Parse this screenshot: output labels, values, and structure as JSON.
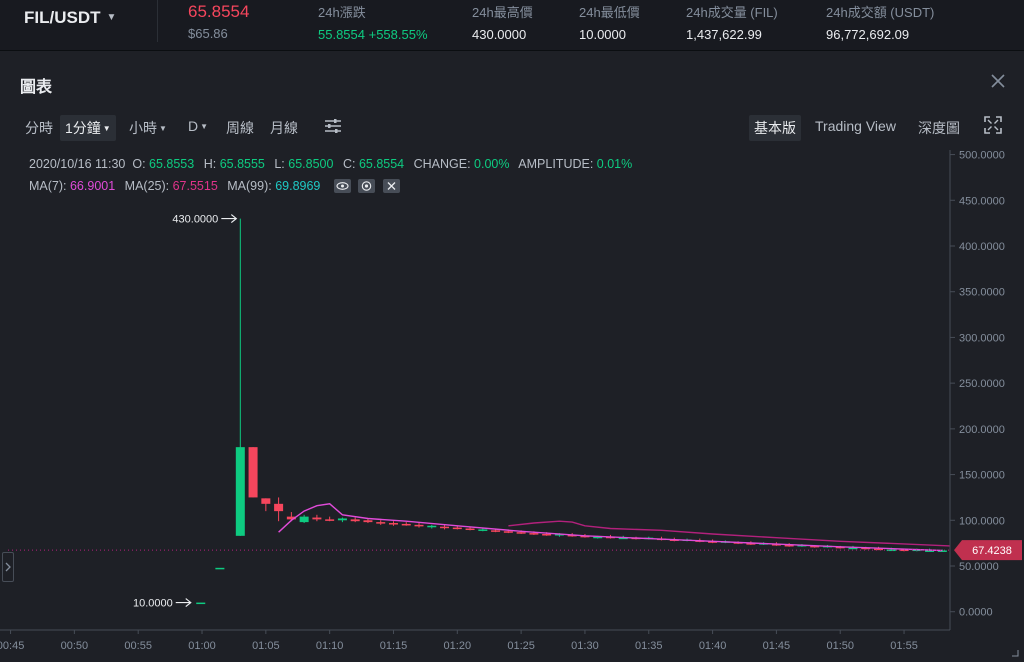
{
  "ticker": {
    "pair": "FIL/USDT",
    "last_price": "65.8554",
    "last_price_usd": "$65.86",
    "stats": [
      {
        "label": "24h漲跌",
        "value": "55.8554 +558.55%",
        "positive": true
      },
      {
        "label": "24h最高價",
        "value": "430.0000",
        "positive": false
      },
      {
        "label": "24h最低價",
        "value": "10.0000",
        "positive": false
      },
      {
        "label": "24h成交量 (FIL)",
        "value": "1,437,622.99",
        "positive": false
      },
      {
        "label": "24h成交額 (USDT)",
        "value": "96,772,692.09",
        "positive": false
      }
    ]
  },
  "panel": {
    "title": "圖表"
  },
  "toolbar": {
    "intervals": [
      {
        "label": "分時",
        "dropdown": false,
        "active": false
      },
      {
        "label": "1分鐘",
        "dropdown": true,
        "active": true
      },
      {
        "label": "小時",
        "dropdown": true,
        "active": false
      },
      {
        "label": "D",
        "dropdown": true,
        "active": false
      },
      {
        "label": "周線",
        "dropdown": false,
        "active": false
      },
      {
        "label": "月線",
        "dropdown": false,
        "active": false
      }
    ],
    "views": [
      {
        "label": "基本版",
        "active": true
      },
      {
        "label": "Trading View",
        "active": false
      },
      {
        "label": "深度圖",
        "active": false
      }
    ]
  },
  "ohlc": {
    "time": "2020/10/16 11:30",
    "o_label": "O:",
    "o": "65.8553",
    "h_label": "H:",
    "h": "65.8555",
    "l_label": "L:",
    "l": "65.8500",
    "c_label": "C:",
    "c": "65.8554",
    "change_label": "CHANGE:",
    "change": "0.00%",
    "amp_label": "AMPLITUDE:",
    "amp": "0.01%"
  },
  "ma": {
    "ma7_label": "MA(7):",
    "ma7": "66.9001",
    "ma25_label": "MA(25):",
    "ma25": "67.5515",
    "ma99_label": "MA(99):",
    "ma99": "69.8969"
  },
  "colors": {
    "up": "#0ecb81",
    "down": "#f6465d",
    "ma7": "#e04bd9",
    "ma25": "#b2217c",
    "bg": "#1e2026",
    "grid": "#2b2f36"
  },
  "chart_data": {
    "type": "candlestick",
    "ylim": [
      -20,
      505
    ],
    "y_ticks": [
      "500.0000",
      "450.0000",
      "400.0000",
      "350.0000",
      "300.0000",
      "250.0000",
      "200.0000",
      "150.0000",
      "100.0000",
      "50.0000",
      "0.0000"
    ],
    "y_tick_values": [
      500,
      450,
      400,
      350,
      300,
      250,
      200,
      150,
      100,
      50,
      0
    ],
    "x_ticks": [
      "00:45",
      "00:50",
      "00:55",
      "01:00",
      "01:05",
      "01:10",
      "01:15",
      "01:20",
      "01:25",
      "01:30",
      "01:35",
      "01:40",
      "01:45",
      "01:50",
      "01:55"
    ],
    "x_tick_minutes": [
      45,
      50,
      55,
      60,
      65,
      70,
      75,
      80,
      85,
      90,
      95,
      100,
      105,
      110,
      115
    ],
    "x_range_minutes": [
      44.8,
      118.6
    ],
    "high_marker": "430.0000",
    "low_marker": "10.0000",
    "last_label": "67.4238",
    "last_value": 67.4238,
    "candles": [
      {
        "t": 59.9,
        "o": 10,
        "h": 10,
        "l": 10,
        "c": 10
      },
      {
        "t": 61.4,
        "o": 48,
        "h": 48,
        "l": 48,
        "c": 48
      },
      {
        "t": 63.0,
        "o": 83,
        "h": 430,
        "l": 83,
        "c": 180
      },
      {
        "t": 64.0,
        "o": 180,
        "h": 180,
        "l": 125,
        "c": 125
      },
      {
        "t": 65.0,
        "o": 124,
        "h": 124,
        "l": 110,
        "c": 118
      },
      {
        "t": 66.0,
        "o": 118,
        "h": 125,
        "l": 99,
        "c": 110
      },
      {
        "t": 67.0,
        "o": 104,
        "h": 109,
        "l": 99,
        "c": 101
      },
      {
        "t": 68.0,
        "o": 98,
        "h": 106,
        "l": 97,
        "c": 104
      },
      {
        "t": 69.0,
        "o": 103,
        "h": 106,
        "l": 99,
        "c": 101
      },
      {
        "t": 70.0,
        "o": 101,
        "h": 104,
        "l": 99,
        "c": 100
      },
      {
        "t": 71.0,
        "o": 100,
        "h": 103,
        "l": 98,
        "c": 102
      },
      {
        "t": 72.0,
        "o": 101,
        "h": 103,
        "l": 98,
        "c": 99
      },
      {
        "t": 73.0,
        "o": 100,
        "h": 102,
        "l": 97,
        "c": 98
      },
      {
        "t": 74.0,
        "o": 98,
        "h": 100,
        "l": 95,
        "c": 97
      },
      {
        "t": 75.0,
        "o": 97,
        "h": 99,
        "l": 94,
        "c": 96
      },
      {
        "t": 76.0,
        "o": 96,
        "h": 98,
        "l": 94,
        "c": 95
      },
      {
        "t": 77.0,
        "o": 95,
        "h": 97,
        "l": 92,
        "c": 94
      },
      {
        "t": 78.0,
        "o": 93,
        "h": 95,
        "l": 91,
        "c": 94
      },
      {
        "t": 79.0,
        "o": 93,
        "h": 95,
        "l": 90,
        "c": 92
      },
      {
        "t": 80.0,
        "o": 92,
        "h": 94,
        "l": 90,
        "c": 91
      },
      {
        "t": 81.0,
        "o": 91,
        "h": 93,
        "l": 89,
        "c": 90
      },
      {
        "t": 82.0,
        "o": 90,
        "h": 92,
        "l": 88,
        "c": 90
      },
      {
        "t": 83.0,
        "o": 89,
        "h": 91,
        "l": 87,
        "c": 88
      },
      {
        "t": 84.0,
        "o": 88,
        "h": 90,
        "l": 86,
        "c": 87
      },
      {
        "t": 85.0,
        "o": 87,
        "h": 89,
        "l": 85,
        "c": 86
      },
      {
        "t": 86.0,
        "o": 86,
        "h": 88,
        "l": 84,
        "c": 85
      },
      {
        "t": 87.0,
        "o": 85,
        "h": 87,
        "l": 83,
        "c": 84
      },
      {
        "t": 88.0,
        "o": 84,
        "h": 86,
        "l": 82,
        "c": 85
      },
      {
        "t": 89.0,
        "o": 84,
        "h": 86,
        "l": 82,
        "c": 83
      },
      {
        "t": 90.0,
        "o": 83,
        "h": 85,
        "l": 81,
        "c": 82
      },
      {
        "t": 91.0,
        "o": 81,
        "h": 83,
        "l": 80,
        "c": 82
      },
      {
        "t": 92.0,
        "o": 82,
        "h": 84,
        "l": 80,
        "c": 81
      },
      {
        "t": 93.0,
        "o": 81,
        "h": 83,
        "l": 80,
        "c": 81
      },
      {
        "t": 94.0,
        "o": 81,
        "h": 82,
        "l": 79,
        "c": 80
      },
      {
        "t": 95.0,
        "o": 80,
        "h": 82,
        "l": 79,
        "c": 81
      },
      {
        "t": 96.0,
        "o": 80,
        "h": 82,
        "l": 78,
        "c": 79
      },
      {
        "t": 97.0,
        "o": 79,
        "h": 81,
        "l": 77,
        "c": 78
      },
      {
        "t": 98.0,
        "o": 78,
        "h": 80,
        "l": 77,
        "c": 79
      },
      {
        "t": 99.0,
        "o": 78,
        "h": 80,
        "l": 76,
        "c": 77
      },
      {
        "t": 100.0,
        "o": 77,
        "h": 79,
        "l": 75,
        "c": 76
      },
      {
        "t": 101.0,
        "o": 76,
        "h": 78,
        "l": 75,
        "c": 77
      },
      {
        "t": 102.0,
        "o": 76,
        "h": 77,
        "l": 74,
        "c": 75
      },
      {
        "t": 103.0,
        "o": 75,
        "h": 77,
        "l": 73,
        "c": 74
      },
      {
        "t": 104.0,
        "o": 74,
        "h": 76,
        "l": 73,
        "c": 75
      },
      {
        "t": 105.0,
        "o": 74,
        "h": 76,
        "l": 72,
        "c": 73
      },
      {
        "t": 106.0,
        "o": 73,
        "h": 75,
        "l": 71,
        "c": 72
      },
      {
        "t": 107.0,
        "o": 72,
        "h": 74,
        "l": 71,
        "c": 73
      },
      {
        "t": 108.0,
        "o": 72,
        "h": 73,
        "l": 70,
        "c": 71
      },
      {
        "t": 109.0,
        "o": 71,
        "h": 73,
        "l": 70,
        "c": 72
      },
      {
        "t": 110.0,
        "o": 71,
        "h": 72,
        "l": 69,
        "c": 70
      },
      {
        "t": 111.0,
        "o": 70,
        "h": 72,
        "l": 69,
        "c": 70
      },
      {
        "t": 112.0,
        "o": 70,
        "h": 71,
        "l": 68,
        "c": 69
      },
      {
        "t": 113.0,
        "o": 69,
        "h": 71,
        "l": 68,
        "c": 68
      },
      {
        "t": 114.0,
        "o": 68,
        "h": 70,
        "l": 67,
        "c": 68
      },
      {
        "t": 115.0,
        "o": 68,
        "h": 69,
        "l": 66,
        "c": 67
      },
      {
        "t": 116.0,
        "o": 67,
        "h": 69,
        "l": 66,
        "c": 68
      },
      {
        "t": 117.0,
        "o": 67,
        "h": 69,
        "l": 66,
        "c": 67
      },
      {
        "t": 118.0,
        "o": 67,
        "h": 68,
        "l": 66,
        "c": 67
      }
    ],
    "ma7_line": [
      {
        "t": 66.0,
        "v": 87
      },
      {
        "t": 67.0,
        "v": 100
      },
      {
        "t": 68.0,
        "v": 110
      },
      {
        "t": 69.0,
        "v": 116
      },
      {
        "t": 70.0,
        "v": 118
      },
      {
        "t": 71.0,
        "v": 106
      },
      {
        "t": 73.0,
        "v": 102
      },
      {
        "t": 76.0,
        "v": 99
      },
      {
        "t": 80.0,
        "v": 94
      },
      {
        "t": 85.0,
        "v": 88
      },
      {
        "t": 90.0,
        "v": 83
      },
      {
        "t": 95.0,
        "v": 80
      },
      {
        "t": 100.0,
        "v": 77
      },
      {
        "t": 105.0,
        "v": 74
      },
      {
        "t": 110.0,
        "v": 71
      },
      {
        "t": 118.0,
        "v": 67
      }
    ],
    "ma25_line": [
      {
        "t": 84.0,
        "v": 94
      },
      {
        "t": 86.0,
        "v": 97
      },
      {
        "t": 88.0,
        "v": 99
      },
      {
        "t": 89.0,
        "v": 98
      },
      {
        "t": 90.0,
        "v": 94
      },
      {
        "t": 92.0,
        "v": 91
      },
      {
        "t": 96.0,
        "v": 89
      },
      {
        "t": 100.0,
        "v": 85
      },
      {
        "t": 105.0,
        "v": 81
      },
      {
        "t": 110.0,
        "v": 77
      },
      {
        "t": 118.6,
        "v": 72
      }
    ]
  }
}
